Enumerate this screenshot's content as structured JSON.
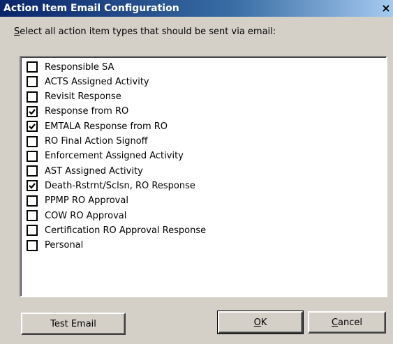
{
  "window": {
    "title": "Action Item Email Configuration",
    "close_glyph": "×"
  },
  "prompt": {
    "accel": "S",
    "rest": "elect all action item types that should be sent via email:"
  },
  "items": [
    {
      "label": "Responsible SA",
      "checked": false
    },
    {
      "label": "ACTS Assigned Activity",
      "checked": false
    },
    {
      "label": "Revisit Response",
      "checked": false
    },
    {
      "label": "Response from RO",
      "checked": true
    },
    {
      "label": "EMTALA Response from RO",
      "checked": true
    },
    {
      "label": "RO Final Action Signoff",
      "checked": false
    },
    {
      "label": "Enforcement Assigned Activity",
      "checked": false
    },
    {
      "label": "AST Assigned Activity",
      "checked": false
    },
    {
      "label": "Death-Rstrnt/Sclsn, RO Response",
      "checked": true
    },
    {
      "label": "PPMP RO Approval",
      "checked": false
    },
    {
      "label": "COW RO Approval",
      "checked": false
    },
    {
      "label": "Certification RO Approval Response",
      "checked": false
    },
    {
      "label": "Personal",
      "checked": false
    }
  ],
  "buttons": {
    "test_email": "Test Email",
    "ok_accel": "O",
    "ok_rest": "K",
    "cancel_accel": "C",
    "cancel_rest": "ancel"
  },
  "icons": {
    "close": "close-icon",
    "check": "checkmark-icon"
  }
}
